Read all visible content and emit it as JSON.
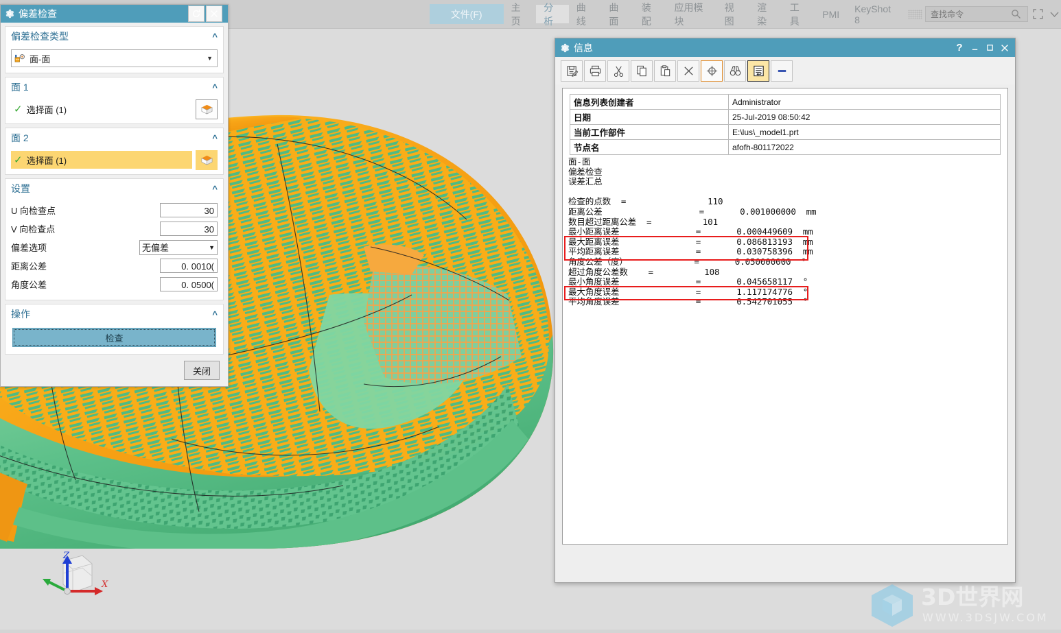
{
  "ribbon": {
    "file_label": "文件(F)",
    "tabs": [
      {
        "label": "主页",
        "active": false
      },
      {
        "label": "分析",
        "active": true
      },
      {
        "label": "曲线",
        "active": false
      },
      {
        "label": "曲面",
        "active": false
      },
      {
        "label": "装配",
        "active": false
      },
      {
        "label": "应用模块",
        "active": false
      },
      {
        "label": "视图",
        "active": false
      },
      {
        "label": "渲染",
        "active": false
      },
      {
        "label": "工具",
        "active": false
      },
      {
        "label": "PMI",
        "active": false
      },
      {
        "label": "KeyShot 8",
        "active": false
      }
    ],
    "search": {
      "value": "",
      "placeholder": "查找命令"
    },
    "icons": [
      "search-icon",
      "fullscreen-icon",
      "chevron-down-icon"
    ]
  },
  "deviation_dialog": {
    "title": "偏差检查",
    "title_icons": [
      "gear-icon",
      "reset-icon",
      "close-icon"
    ],
    "sections": {
      "type": {
        "header": "偏差检查类型",
        "selected": "面-面",
        "icon": "measure-icon"
      },
      "face1": {
        "header": "面 1",
        "select_label": "选择面 (1)",
        "check_icon": "check-icon",
        "face_icon": "face-select-icon"
      },
      "face2": {
        "header": "面 2",
        "select_label": "选择面 (1)",
        "check_icon": "check-icon",
        "face_icon": "face-select-icon",
        "highlighted": true
      },
      "settings": {
        "header": "设置",
        "fields": [
          {
            "label": "U 向检查点",
            "value": "30",
            "type": "number"
          },
          {
            "label": "V 向检查点",
            "value": "30",
            "type": "number"
          },
          {
            "label": "偏差选项",
            "value": "无偏差",
            "type": "select"
          },
          {
            "label": "距离公差",
            "value": "0. 0010(",
            "type": "number"
          },
          {
            "label": "角度公差",
            "value": "0. 0500(",
            "type": "number"
          }
        ]
      },
      "action": {
        "header": "操作",
        "button_label": "检查"
      }
    },
    "close_label": "关闭"
  },
  "info_window": {
    "title": "信息",
    "title_icons": [
      "gear-icon",
      "help-icon",
      "minimize-icon",
      "maximize-icon",
      "close-icon"
    ],
    "toolbar": [
      {
        "name": "save-as-icon",
        "state": "normal"
      },
      {
        "name": "print-icon",
        "state": "normal"
      },
      {
        "name": "cut-icon",
        "state": "normal"
      },
      {
        "name": "copy-icon",
        "state": "normal"
      },
      {
        "name": "paste-icon",
        "state": "normal"
      },
      {
        "name": "delete-icon",
        "state": "normal"
      },
      {
        "name": "crosshair-icon",
        "state": "selected"
      },
      {
        "name": "find-icon",
        "state": "normal"
      },
      {
        "name": "word-wrap-icon",
        "state": "active"
      },
      {
        "name": "minus-icon",
        "state": "normal"
      }
    ],
    "header_table": [
      {
        "key": "信息列表创建者",
        "value": "Administrator"
      },
      {
        "key": "日期",
        "value": "25-Jul-2019 08:50:42"
      },
      {
        "key": "当前工作部件",
        "value": "E:\\lus\\_model1.prt"
      },
      {
        "key": "节点名",
        "value": "afofh-801172022"
      }
    ],
    "report_lines": [
      "面-面",
      "偏差检查",
      "误差汇总",
      "",
      "检查的点数  =                110",
      "距离公差                   =       0.001000000  mm",
      "数目超过距离公差  =          101",
      "最小距离误差               =       0.000449609  mm",
      "最大距离误差               =       0.086813193  mm",
      "平均距离误差               =       0.030758396  mm",
      "角度公差（度）             =       0.050000000  °",
      "超过角度公差数    =          108",
      "最小角度误差               =       0.045658117  °",
      "最大角度误差               =       1.117174776  °",
      "平均角度误差               =       0.542701055  °"
    ],
    "highlights": [
      {
        "name": "highlight-distance-errors",
        "lines": [
          8,
          9
        ],
        "color": "#e81c1c"
      },
      {
        "name": "highlight-max-angle-error",
        "lines": [
          13
        ],
        "color": "#e81c1c"
      }
    ]
  },
  "viewport": {
    "triad": {
      "z_label": "Z",
      "x_label": "X",
      "z_color": "#1f3fd4",
      "x_color": "#d42a2a",
      "y_color": "#2aaa3c"
    },
    "colors": {
      "face_orange": "#f59c14",
      "face_orange_light": "#ffbb33",
      "face_green": "#4fbb82",
      "face_green_light": "#7fd39a",
      "background": "#dcdcdc"
    }
  },
  "watermark": {
    "text": "3D世界网",
    "url": "WWW.3DSJW.COM",
    "color": "#9fd4ee"
  }
}
